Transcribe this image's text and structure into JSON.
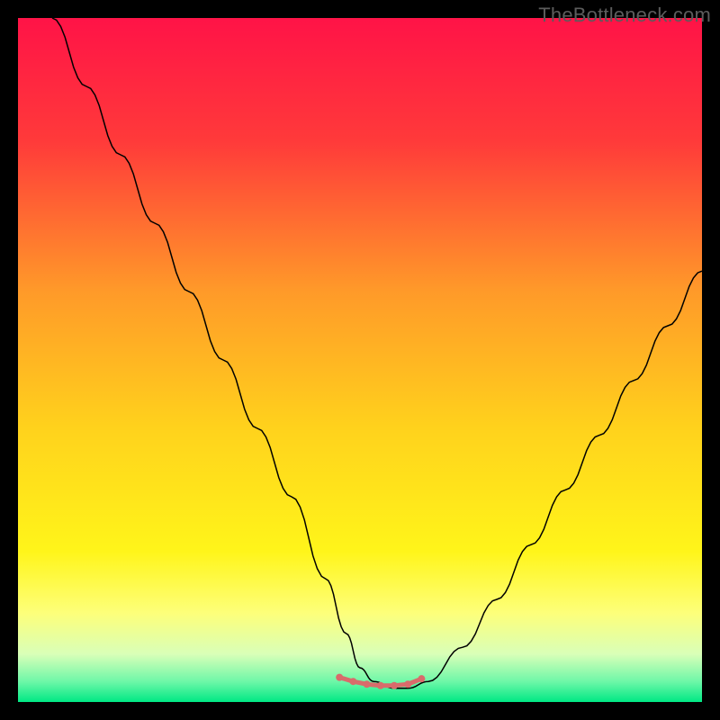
{
  "watermark": "TheBottleneck.com",
  "chart_data": {
    "type": "line",
    "title": "",
    "xlabel": "",
    "ylabel": "",
    "xlim": [
      0,
      100
    ],
    "ylim": [
      0,
      100
    ],
    "grid": false,
    "legend": false,
    "background_gradient_stops": [
      {
        "offset": 0.0,
        "color": "#ff1347"
      },
      {
        "offset": 0.18,
        "color": "#ff3a3a"
      },
      {
        "offset": 0.4,
        "color": "#ff9a29"
      },
      {
        "offset": 0.6,
        "color": "#ffd21c"
      },
      {
        "offset": 0.78,
        "color": "#fff51a"
      },
      {
        "offset": 0.87,
        "color": "#fdff7a"
      },
      {
        "offset": 0.93,
        "color": "#d9ffb8"
      },
      {
        "offset": 0.97,
        "color": "#6ef7a8"
      },
      {
        "offset": 1.0,
        "color": "#00e884"
      }
    ],
    "series": [
      {
        "name": "bottleneck-curve",
        "color": "#000000",
        "width": 1.5,
        "x": [
          5,
          10,
          15,
          20,
          25,
          30,
          35,
          40,
          45,
          48,
          50,
          52,
          55,
          57,
          60,
          65,
          70,
          75,
          80,
          85,
          90,
          95,
          100
        ],
        "values": [
          100,
          90,
          80,
          70,
          60,
          50,
          40,
          30,
          18,
          10,
          5,
          3,
          2,
          2,
          3,
          8,
          15,
          23,
          31,
          39,
          47,
          55,
          63
        ]
      }
    ],
    "flat_segment": {
      "name": "bottom-marker",
      "color": "#d96b6b",
      "width": 5,
      "markers": true,
      "marker_radius": 4,
      "x": [
        47,
        49,
        51,
        53,
        55,
        57,
        59
      ],
      "values": [
        3.6,
        3.0,
        2.6,
        2.4,
        2.4,
        2.6,
        3.4
      ]
    }
  }
}
